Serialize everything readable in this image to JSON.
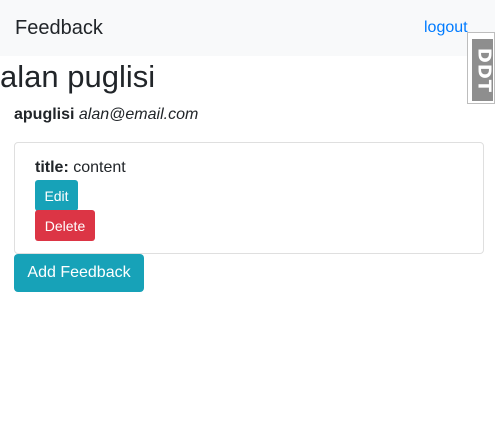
{
  "navbar": {
    "brand": "Feedback",
    "logout_label": "logout"
  },
  "debug_tab": {
    "label": "DDT"
  },
  "user": {
    "full_name": "alan puglisi",
    "username": "apuglisi",
    "email": "alan@email.com"
  },
  "feedback": [
    {
      "title_key": "title:",
      "title_value": "content",
      "edit_label": "Edit",
      "delete_label": "Delete"
    }
  ],
  "actions": {
    "add_label": "Add Feedback"
  },
  "colors": {
    "primary_link": "#007bff",
    "info_button": "#17a2b8",
    "danger_button": "#dc3545",
    "navbar_bg": "#f8f9fa"
  }
}
